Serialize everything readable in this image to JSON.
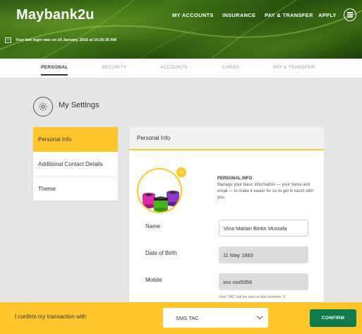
{
  "header": {
    "logo": "Maybank2u",
    "nav": [
      "MY ACCOUNTS",
      "INSURANCE",
      "PAY & TRANSFER",
      "APPLY"
    ],
    "last_login": "Your last login was on 14 January, 2016 at 10:20:35 AM"
  },
  "tabs": [
    "PERSONAL",
    "SECURITY",
    "ACCOUNTS",
    "CARDS",
    "PAY & TRANSFER"
  ],
  "settings": {
    "title": "My Settings"
  },
  "left_menu": [
    "Personal Info",
    "Additional Contact Details",
    "Theme"
  ],
  "card": {
    "title": "Personal Info",
    "info_title": "PERSONAL INFO",
    "info_desc": "Manage your basic information — your name and email — to make it easier for us to get in touch with you.",
    "fields": {
      "name": {
        "label": "Name",
        "value": "Vina Marian Bintin Mustafa"
      },
      "dob": {
        "label": "Date of Birth",
        "value": "11 May 1983"
      },
      "mobile": {
        "label": "Mobile",
        "value": "xxx xxx5356"
      }
    },
    "tac_note": "Your TAC will be sent to this number. If"
  },
  "footer": {
    "text": "I confirm my transaction with",
    "select_value": "SMS TAC",
    "confirm_label": "CONFIRM"
  },
  "colors": {
    "accent": "#ffc72c",
    "confirm": "#0f7a4c"
  }
}
